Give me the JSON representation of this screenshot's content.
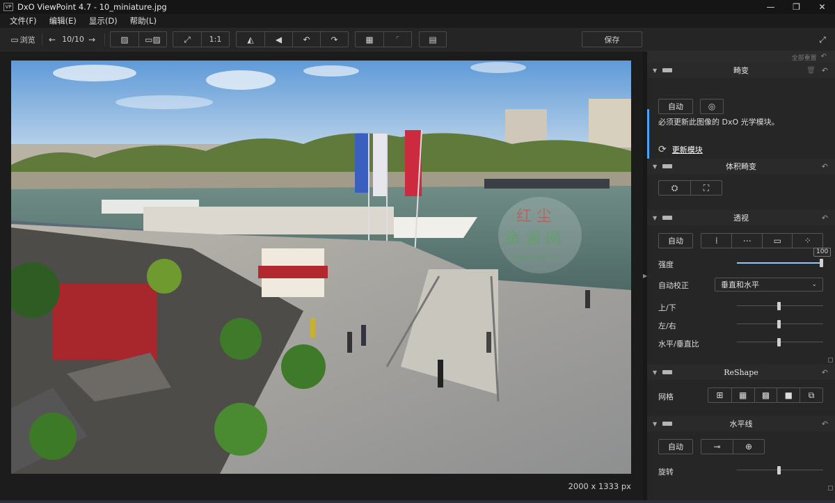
{
  "window": {
    "logo": "VP",
    "title": "DxO ViewPoint 4.7 - 10_miniature.jpg",
    "controls": [
      "—",
      "❐",
      "✕"
    ]
  },
  "menu": [
    "文件(F)",
    "编辑(E)",
    "显示(D)",
    "帮助(L)"
  ],
  "toolbar": {
    "browse_label": "浏览",
    "counter": "10/10",
    "one_to_one": "1:1",
    "save_label": "保存"
  },
  "canvas": {
    "image_size": "2000 x 1333 px",
    "watermark_line1": "红 尘",
    "watermark_line2": "资 源 网",
    "watermark_url": "www.hcw3.cn"
  },
  "panel": {
    "reset_all": "全部重置",
    "distortion": {
      "title": "畸变",
      "auto_label": "自动",
      "notice": "必须更新此图像的 DxO 光学模块。",
      "update_label": "更新模块"
    },
    "volume": {
      "title": "体积畸变"
    },
    "perspective": {
      "title": "透视",
      "auto_label": "自动",
      "intensity_label": "强度",
      "intensity_value": "100",
      "intensity_fraction": 1.0,
      "auto_correct_label": "自动校正",
      "auto_correct_value": "垂直和水平",
      "updown_label": "上/下",
      "leftright_label": "左/右",
      "ratio_label": "水平/垂直比"
    },
    "reshape": {
      "title": "ReShape",
      "grid_label": "网格"
    },
    "horizon": {
      "title": "水平线",
      "auto_label": "自动",
      "rotate_label": "旋转"
    }
  }
}
